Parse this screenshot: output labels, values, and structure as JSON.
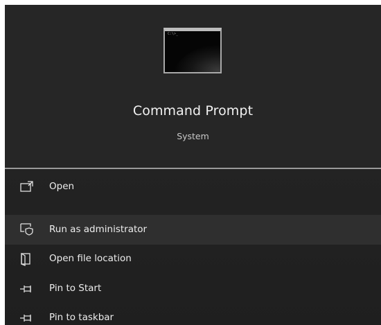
{
  "app": {
    "title": "Command Prompt",
    "subtitle": "System",
    "icon": "command-prompt-icon"
  },
  "menu": {
    "items": [
      {
        "label": "Open",
        "icon": "open-icon"
      },
      {
        "label": "Run as administrator",
        "icon": "run-as-admin-icon",
        "highlighted": true
      },
      {
        "label": "Open file location",
        "icon": "file-location-icon"
      },
      {
        "label": "Pin to Start",
        "icon": "pin-icon"
      },
      {
        "label": "Pin to taskbar",
        "icon": "pin-icon"
      }
    ]
  },
  "colors": {
    "panel": "#262626",
    "menu": "#212121",
    "hover": "#2f2f2f",
    "divider": "#9a9a9a",
    "text": "#ededed"
  }
}
